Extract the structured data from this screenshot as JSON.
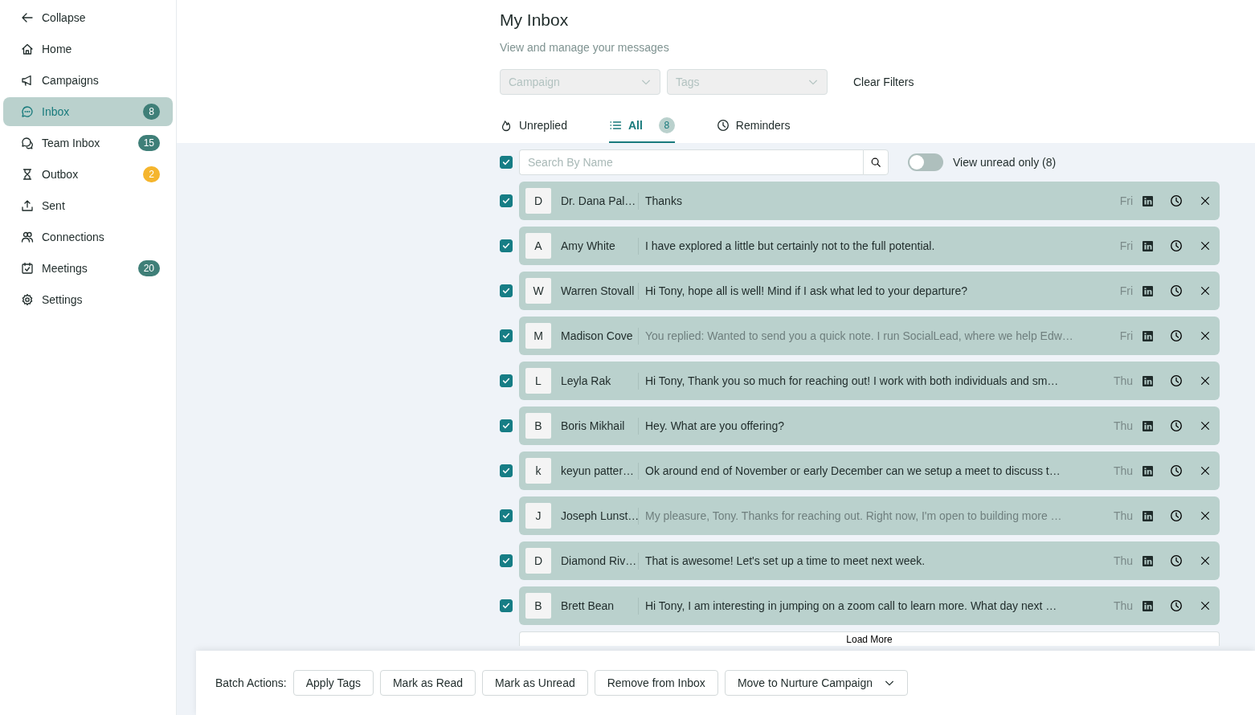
{
  "sidebar": {
    "collapse": "Collapse",
    "items": [
      {
        "label": "Home",
        "selected": false
      },
      {
        "label": "Campaigns",
        "selected": false
      },
      {
        "label": "Inbox",
        "selected": true,
        "badge": "8",
        "color": "#3f7f78"
      },
      {
        "label": "Team Inbox",
        "selected": false,
        "badge": "15",
        "color": "#3f7f78"
      },
      {
        "label": "Outbox",
        "selected": false,
        "badge": "2",
        "color": "#f5b52d"
      },
      {
        "label": "Sent",
        "selected": false
      },
      {
        "label": "Connections",
        "selected": false
      },
      {
        "label": "Meetings",
        "selected": false,
        "badge": "20",
        "color": "#3f7f78"
      },
      {
        "label": "Settings",
        "selected": false
      }
    ]
  },
  "header": {
    "title": "My Inbox",
    "subtitle": "View and manage your messages"
  },
  "filters": {
    "campaign": {
      "placeholder": "Campaign"
    },
    "tags": {
      "placeholder": "Tags"
    },
    "clear": "Clear Filters"
  },
  "tabs": [
    {
      "label": "Unreplied",
      "selected": false
    },
    {
      "label": "All",
      "selected": true,
      "count": "8"
    },
    {
      "label": "Reminders",
      "selected": false
    }
  ],
  "toolbar": {
    "select_all": {
      "checked": true
    },
    "search": {
      "placeholder": "Search By Name"
    },
    "unread_toggle": {
      "label": "View unread only (8)",
      "on": false
    }
  },
  "messages": [
    {
      "initial": "D",
      "name": "Dr. Dana Pal…",
      "text": "Thanks",
      "day": "Fri",
      "checked": true,
      "replied": false
    },
    {
      "initial": "A",
      "name": "Amy White",
      "text": "I have explored a little but certainly not to the full potential.",
      "day": "Fri",
      "checked": true,
      "replied": false
    },
    {
      "initial": "W",
      "name": "Warren Stovall",
      "text": "Hi Tony, hope all is well! Mind if I ask what led to your departure?",
      "day": "Fri",
      "checked": true,
      "replied": false
    },
    {
      "initial": "M",
      "name": "Madison Cove",
      "text": "You replied: Wanted to send you a quick note. I run SocialLead, where we help Edw…",
      "day": "Fri",
      "checked": true,
      "replied": true
    },
    {
      "initial": "L",
      "name": "Leyla Rak",
      "text": "Hi Tony, Thank you so much for reaching out! I work with both individuals and sm…",
      "day": "Thu",
      "checked": true,
      "replied": false
    },
    {
      "initial": "B",
      "name": "Boris Mikhail",
      "text": "Hey. What are you offering?",
      "day": "Thu",
      "checked": true,
      "replied": false
    },
    {
      "initial": "k",
      "name": "keyun patter…",
      "text": "Ok around end of November or early December can we setup a meet to discuss t…",
      "day": "Thu",
      "checked": true,
      "replied": false
    },
    {
      "initial": "J",
      "name": "Joseph Lunst…",
      "text": "My pleasure, Tony. Thanks for reaching out. Right now, I'm open to building more …",
      "day": "Thu",
      "checked": true,
      "replied": true
    },
    {
      "initial": "D",
      "name": "Diamond Riv…",
      "text": "That is awesome! Let's set up a time to meet next week.",
      "day": "Thu",
      "checked": true,
      "replied": false
    },
    {
      "initial": "B",
      "name": "Brett Bean",
      "text": "Hi Tony, I am interesting in jumping on a zoom call to learn more. What day next …",
      "day": "Thu",
      "checked": true,
      "replied": false
    }
  ],
  "load_more": "Load More",
  "batch": {
    "label": "Batch Actions:",
    "actions": [
      {
        "label": "Apply Tags",
        "kind": "button"
      },
      {
        "label": "Mark as Read",
        "kind": "button"
      },
      {
        "label": "Mark as Unread",
        "kind": "button"
      },
      {
        "label": "Remove from Inbox",
        "kind": "button"
      },
      {
        "label": "Move to Nurture Campaign",
        "kind": "dropdown"
      }
    ]
  }
}
